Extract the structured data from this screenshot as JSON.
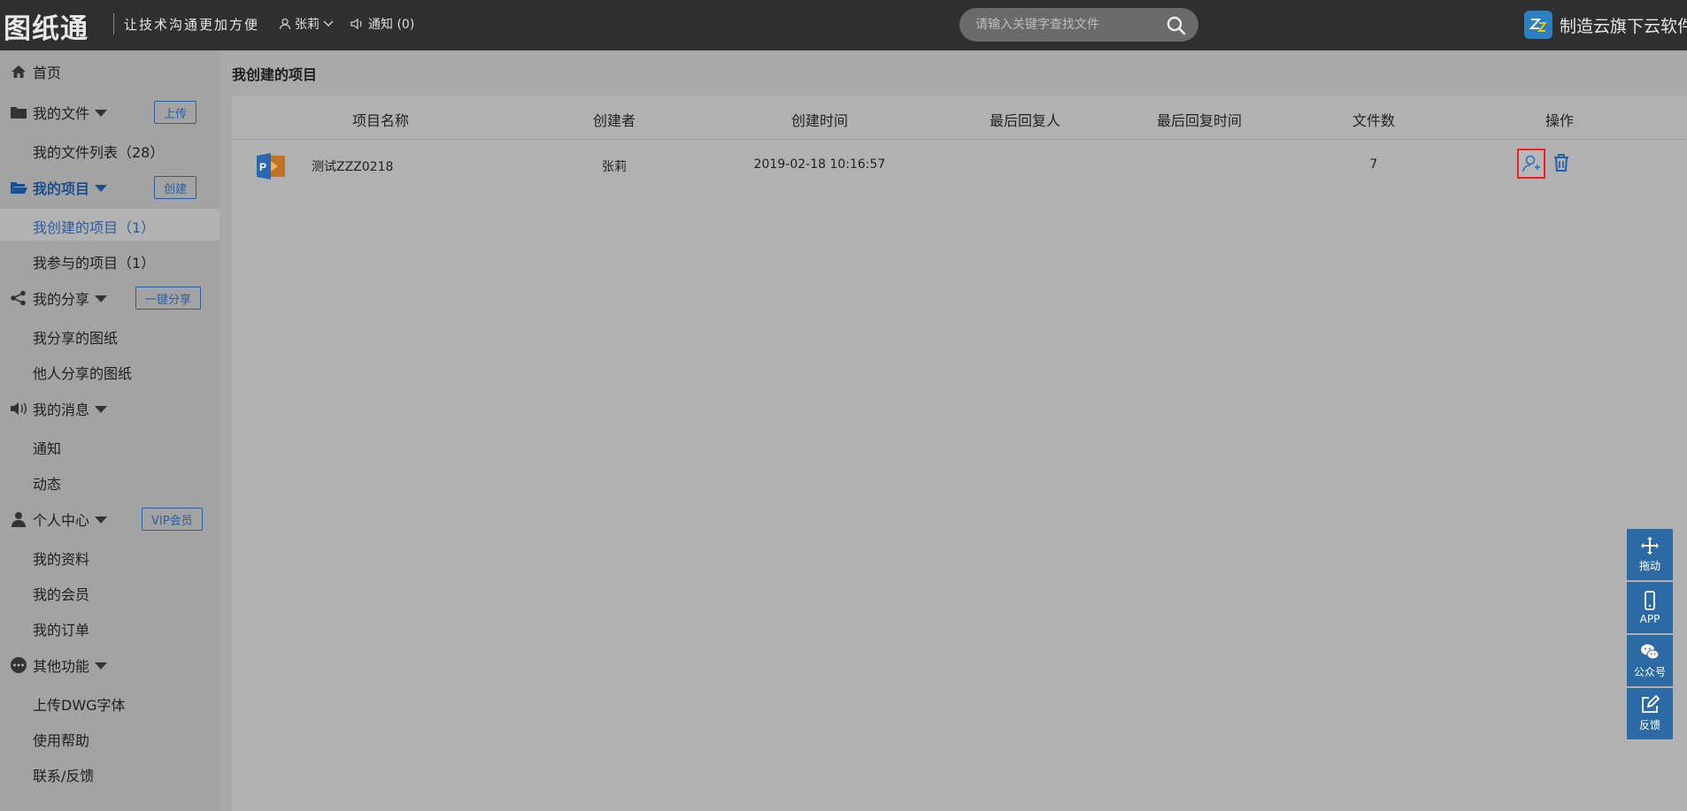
{
  "header": {
    "logo": "图纸通",
    "slogan": "让技术沟通更加方便",
    "user_name": "张莉",
    "notice_label": "通知 (0)",
    "search_placeholder": "请输入关键字查找文件",
    "brand_text": "制造云旗下云软件"
  },
  "sidebar": {
    "home": "首页",
    "files": {
      "label": "我的文件",
      "button": "上传",
      "items": [
        "我的文件列表（28）"
      ]
    },
    "projects": {
      "label": "我的项目",
      "button": "创建",
      "items": [
        "我创建的项目（1）",
        "我参与的项目（1）"
      ]
    },
    "share": {
      "label": "我的分享",
      "button": "一键分享",
      "items": [
        "我分享的图纸",
        "他人分享的图纸"
      ]
    },
    "messages": {
      "label": "我的消息",
      "items": [
        "通知",
        "动态"
      ]
    },
    "personal": {
      "label": "个人中心",
      "button": "VIP会员",
      "items": [
        "我的资料",
        "我的会员",
        "我的订单"
      ]
    },
    "other": {
      "label": "其他功能",
      "items": [
        "上传DWG字体",
        "使用帮助",
        "联系/反馈"
      ]
    }
  },
  "main": {
    "title": "我创建的项目",
    "columns": [
      "项目名称",
      "创建者",
      "创建时间",
      "最后回复人",
      "最后回复时间",
      "文件数",
      "操作"
    ],
    "rows": [
      {
        "name": "测试ZZZ0218",
        "creator": "张莉",
        "created": "2019-02-18 10:16:57",
        "last_replier": "",
        "last_reply_time": "",
        "file_count": "7"
      }
    ]
  },
  "float_toolbar": [
    "拖动",
    "APP",
    "公众号",
    "反馈"
  ],
  "colors": {
    "header_bg": "#2f2f2f",
    "accent": "#2b5fa0",
    "highlight": "#e32626",
    "float_bg": "#2c6aa6"
  }
}
